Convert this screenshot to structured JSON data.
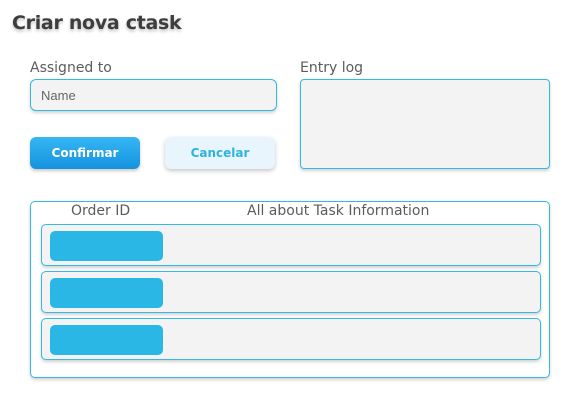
{
  "page": {
    "title": "Criar nova ctask"
  },
  "form": {
    "assigned_to_label": "Assigned to",
    "name_placeholder": "Name",
    "name_value": "",
    "entry_log_label": "Entry log",
    "entry_log_value": ""
  },
  "buttons": {
    "confirm_label": "Confirmar",
    "cancel_label": "Cancelar"
  },
  "task_table": {
    "headers": {
      "order_id": "Order ID",
      "info": "All about Task Information"
    },
    "rows": [
      {
        "order_id": "",
        "info": ""
      },
      {
        "order_id": "",
        "info": ""
      },
      {
        "order_id": "",
        "info": ""
      }
    ]
  },
  "colors": {
    "accent_blue": "#33b9e2",
    "confirm_blue": "#1a9ee6",
    "chip_blue": "#2ab7e5",
    "cancel_bg": "#e8f5fc",
    "field_bg": "#f3f3f3"
  }
}
